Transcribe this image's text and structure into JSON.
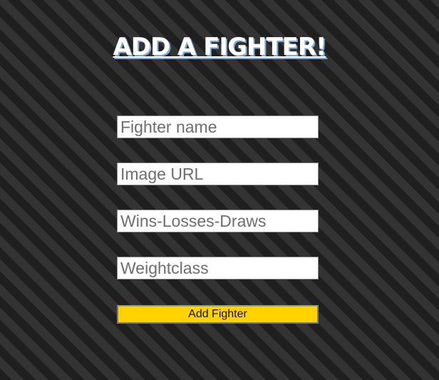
{
  "page": {
    "title": "ADD A FIGHTER!"
  },
  "form": {
    "fields": [
      {
        "placeholder": "Fighter name",
        "value": ""
      },
      {
        "placeholder": "Image URL",
        "value": ""
      },
      {
        "placeholder": "Wins-Losses-Draws",
        "value": ""
      },
      {
        "placeholder": "Weightclass",
        "value": ""
      }
    ],
    "submit_label": "Add Fighter"
  },
  "colors": {
    "submit_background": "#ffd200",
    "title_shadow": "#7fa6d6",
    "stripe_dark": "#1f1f1f",
    "stripe_light": "#333333"
  }
}
